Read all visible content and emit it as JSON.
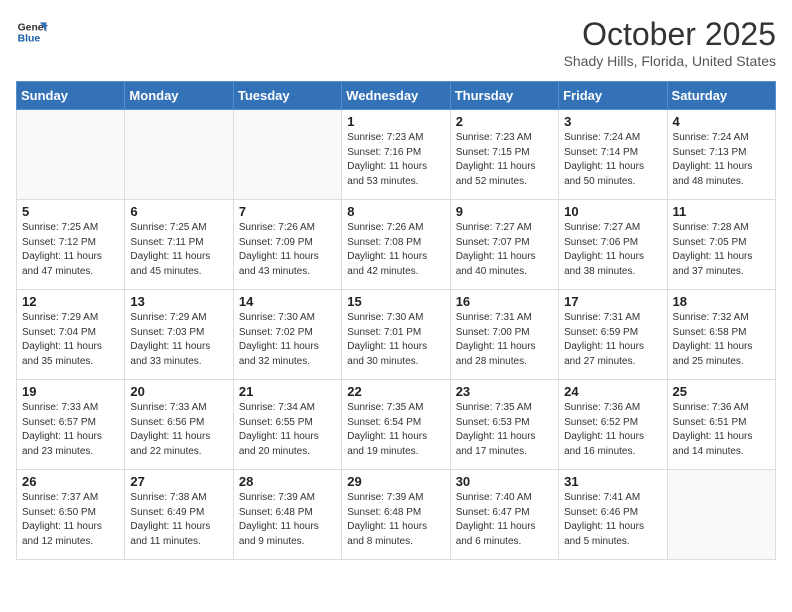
{
  "header": {
    "logo_line1": "General",
    "logo_line2": "Blue",
    "month": "October 2025",
    "location": "Shady Hills, Florida, United States"
  },
  "weekdays": [
    "Sunday",
    "Monday",
    "Tuesday",
    "Wednesday",
    "Thursday",
    "Friday",
    "Saturday"
  ],
  "weeks": [
    [
      {
        "day": "",
        "sunrise": "",
        "sunset": "",
        "daylight": ""
      },
      {
        "day": "",
        "sunrise": "",
        "sunset": "",
        "daylight": ""
      },
      {
        "day": "",
        "sunrise": "",
        "sunset": "",
        "daylight": ""
      },
      {
        "day": "1",
        "sunrise": "Sunrise: 7:23 AM",
        "sunset": "Sunset: 7:16 PM",
        "daylight": "Daylight: 11 hours and 53 minutes."
      },
      {
        "day": "2",
        "sunrise": "Sunrise: 7:23 AM",
        "sunset": "Sunset: 7:15 PM",
        "daylight": "Daylight: 11 hours and 52 minutes."
      },
      {
        "day": "3",
        "sunrise": "Sunrise: 7:24 AM",
        "sunset": "Sunset: 7:14 PM",
        "daylight": "Daylight: 11 hours and 50 minutes."
      },
      {
        "day": "4",
        "sunrise": "Sunrise: 7:24 AM",
        "sunset": "Sunset: 7:13 PM",
        "daylight": "Daylight: 11 hours and 48 minutes."
      }
    ],
    [
      {
        "day": "5",
        "sunrise": "Sunrise: 7:25 AM",
        "sunset": "Sunset: 7:12 PM",
        "daylight": "Daylight: 11 hours and 47 minutes."
      },
      {
        "day": "6",
        "sunrise": "Sunrise: 7:25 AM",
        "sunset": "Sunset: 7:11 PM",
        "daylight": "Daylight: 11 hours and 45 minutes."
      },
      {
        "day": "7",
        "sunrise": "Sunrise: 7:26 AM",
        "sunset": "Sunset: 7:09 PM",
        "daylight": "Daylight: 11 hours and 43 minutes."
      },
      {
        "day": "8",
        "sunrise": "Sunrise: 7:26 AM",
        "sunset": "Sunset: 7:08 PM",
        "daylight": "Daylight: 11 hours and 42 minutes."
      },
      {
        "day": "9",
        "sunrise": "Sunrise: 7:27 AM",
        "sunset": "Sunset: 7:07 PM",
        "daylight": "Daylight: 11 hours and 40 minutes."
      },
      {
        "day": "10",
        "sunrise": "Sunrise: 7:27 AM",
        "sunset": "Sunset: 7:06 PM",
        "daylight": "Daylight: 11 hours and 38 minutes."
      },
      {
        "day": "11",
        "sunrise": "Sunrise: 7:28 AM",
        "sunset": "Sunset: 7:05 PM",
        "daylight": "Daylight: 11 hours and 37 minutes."
      }
    ],
    [
      {
        "day": "12",
        "sunrise": "Sunrise: 7:29 AM",
        "sunset": "Sunset: 7:04 PM",
        "daylight": "Daylight: 11 hours and 35 minutes."
      },
      {
        "day": "13",
        "sunrise": "Sunrise: 7:29 AM",
        "sunset": "Sunset: 7:03 PM",
        "daylight": "Daylight: 11 hours and 33 minutes."
      },
      {
        "day": "14",
        "sunrise": "Sunrise: 7:30 AM",
        "sunset": "Sunset: 7:02 PM",
        "daylight": "Daylight: 11 hours and 32 minutes."
      },
      {
        "day": "15",
        "sunrise": "Sunrise: 7:30 AM",
        "sunset": "Sunset: 7:01 PM",
        "daylight": "Daylight: 11 hours and 30 minutes."
      },
      {
        "day": "16",
        "sunrise": "Sunrise: 7:31 AM",
        "sunset": "Sunset: 7:00 PM",
        "daylight": "Daylight: 11 hours and 28 minutes."
      },
      {
        "day": "17",
        "sunrise": "Sunrise: 7:31 AM",
        "sunset": "Sunset: 6:59 PM",
        "daylight": "Daylight: 11 hours and 27 minutes."
      },
      {
        "day": "18",
        "sunrise": "Sunrise: 7:32 AM",
        "sunset": "Sunset: 6:58 PM",
        "daylight": "Daylight: 11 hours and 25 minutes."
      }
    ],
    [
      {
        "day": "19",
        "sunrise": "Sunrise: 7:33 AM",
        "sunset": "Sunset: 6:57 PM",
        "daylight": "Daylight: 11 hours and 23 minutes."
      },
      {
        "day": "20",
        "sunrise": "Sunrise: 7:33 AM",
        "sunset": "Sunset: 6:56 PM",
        "daylight": "Daylight: 11 hours and 22 minutes."
      },
      {
        "day": "21",
        "sunrise": "Sunrise: 7:34 AM",
        "sunset": "Sunset: 6:55 PM",
        "daylight": "Daylight: 11 hours and 20 minutes."
      },
      {
        "day": "22",
        "sunrise": "Sunrise: 7:35 AM",
        "sunset": "Sunset: 6:54 PM",
        "daylight": "Daylight: 11 hours and 19 minutes."
      },
      {
        "day": "23",
        "sunrise": "Sunrise: 7:35 AM",
        "sunset": "Sunset: 6:53 PM",
        "daylight": "Daylight: 11 hours and 17 minutes."
      },
      {
        "day": "24",
        "sunrise": "Sunrise: 7:36 AM",
        "sunset": "Sunset: 6:52 PM",
        "daylight": "Daylight: 11 hours and 16 minutes."
      },
      {
        "day": "25",
        "sunrise": "Sunrise: 7:36 AM",
        "sunset": "Sunset: 6:51 PM",
        "daylight": "Daylight: 11 hours and 14 minutes."
      }
    ],
    [
      {
        "day": "26",
        "sunrise": "Sunrise: 7:37 AM",
        "sunset": "Sunset: 6:50 PM",
        "daylight": "Daylight: 11 hours and 12 minutes."
      },
      {
        "day": "27",
        "sunrise": "Sunrise: 7:38 AM",
        "sunset": "Sunset: 6:49 PM",
        "daylight": "Daylight: 11 hours and 11 minutes."
      },
      {
        "day": "28",
        "sunrise": "Sunrise: 7:39 AM",
        "sunset": "Sunset: 6:48 PM",
        "daylight": "Daylight: 11 hours and 9 minutes."
      },
      {
        "day": "29",
        "sunrise": "Sunrise: 7:39 AM",
        "sunset": "Sunset: 6:48 PM",
        "daylight": "Daylight: 11 hours and 8 minutes."
      },
      {
        "day": "30",
        "sunrise": "Sunrise: 7:40 AM",
        "sunset": "Sunset: 6:47 PM",
        "daylight": "Daylight: 11 hours and 6 minutes."
      },
      {
        "day": "31",
        "sunrise": "Sunrise: 7:41 AM",
        "sunset": "Sunset: 6:46 PM",
        "daylight": "Daylight: 11 hours and 5 minutes."
      },
      {
        "day": "",
        "sunrise": "",
        "sunset": "",
        "daylight": ""
      }
    ]
  ]
}
